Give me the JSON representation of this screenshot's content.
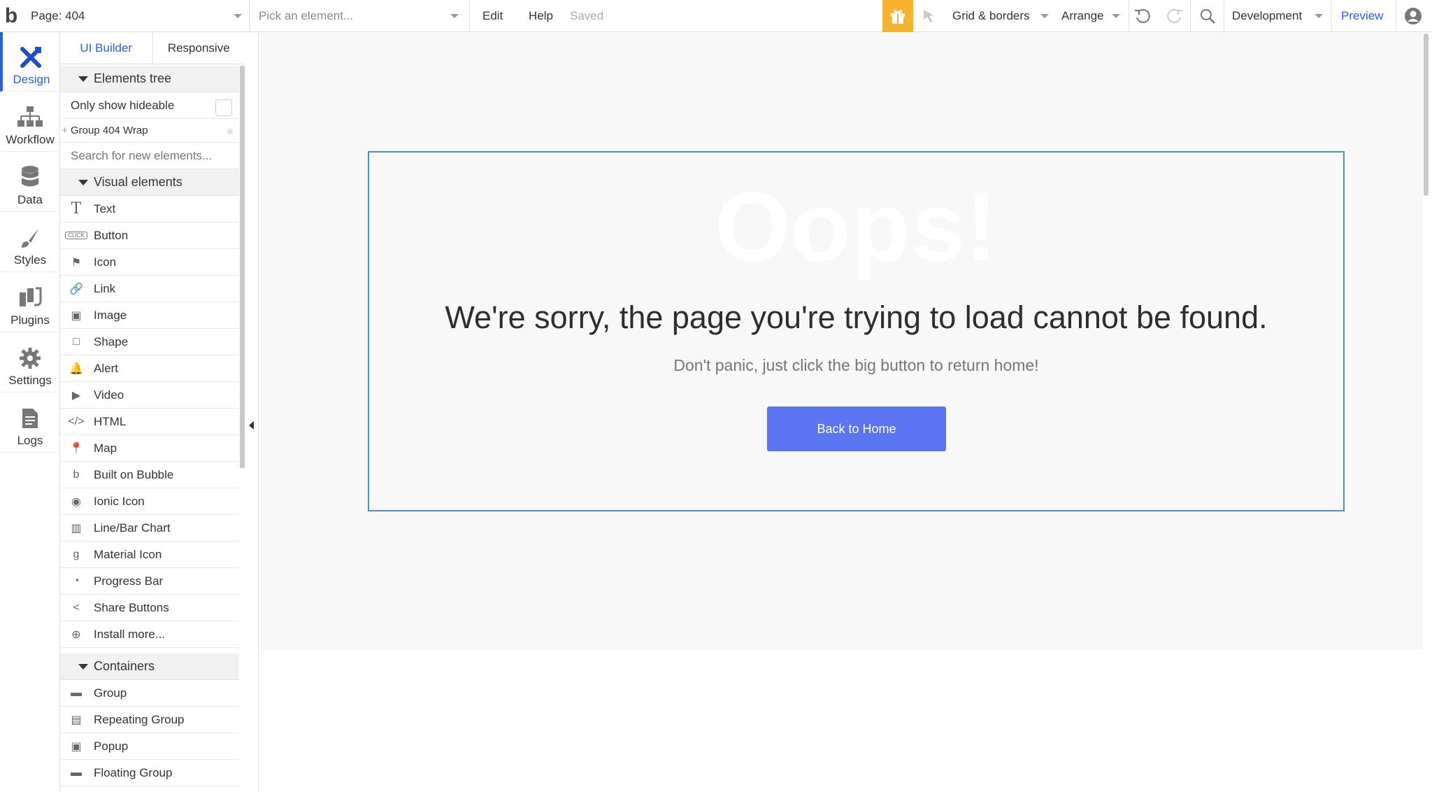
{
  "topbar": {
    "logo": "b",
    "page_label": "Page: 404",
    "element_placeholder": "Pick an element...",
    "edit": "Edit",
    "help": "Help",
    "status": "Saved",
    "grid_borders": "Grid & borders",
    "arrange": "Arrange",
    "environment": "Development",
    "preview": "Preview",
    "gift_color": "#f6b32b"
  },
  "rail": {
    "items": [
      {
        "label": "Design",
        "icon": "design-icon"
      },
      {
        "label": "Workflow",
        "icon": "workflow-icon"
      },
      {
        "label": "Data",
        "icon": "database-icon"
      },
      {
        "label": "Styles",
        "icon": "brush-icon"
      },
      {
        "label": "Plugins",
        "icon": "plug-icon"
      },
      {
        "label": "Settings",
        "icon": "gear-icon"
      },
      {
        "label": "Logs",
        "icon": "document-icon"
      }
    ]
  },
  "panel": {
    "tabs": [
      "UI Builder",
      "Responsive"
    ],
    "elements_tree": "Elements tree",
    "only_hideable": "Only show hideable",
    "tree_item": "Group 404 Wrap",
    "search_placeholder": "Search for new elements...",
    "visual_header": "Visual elements",
    "visual": [
      {
        "label": "Text",
        "icon": "T"
      },
      {
        "label": "Button",
        "icon": "CLICK"
      },
      {
        "label": "Icon",
        "icon": "⚑"
      },
      {
        "label": "Link",
        "icon": "🔗"
      },
      {
        "label": "Image",
        "icon": "▣"
      },
      {
        "label": "Shape",
        "icon": "□"
      },
      {
        "label": "Alert",
        "icon": "🔔"
      },
      {
        "label": "Video",
        "icon": "▶"
      },
      {
        "label": "HTML",
        "icon": "</>"
      },
      {
        "label": "Map",
        "icon": "📍"
      },
      {
        "label": "Built on Bubble",
        "icon": "b"
      },
      {
        "label": "Ionic Icon",
        "icon": "◉"
      },
      {
        "label": "Line/Bar Chart",
        "icon": "▥"
      },
      {
        "label": "Material Icon",
        "icon": "g"
      },
      {
        "label": "Progress Bar",
        "icon": "◔"
      },
      {
        "label": "Share Buttons",
        "icon": "<"
      },
      {
        "label": "Install more...",
        "icon": "⊕"
      }
    ],
    "containers_header": "Containers",
    "containers": [
      {
        "label": "Group",
        "icon": "▬"
      },
      {
        "label": "Repeating Group",
        "icon": "▤"
      },
      {
        "label": "Popup",
        "icon": "▣"
      },
      {
        "label": "Floating Group",
        "icon": "▬"
      }
    ]
  },
  "canvas": {
    "oops": "Oops!",
    "sorry": "We're sorry, the page you're trying to load cannot be found.",
    "panic": "Don't panic, just click the big button to return home!",
    "button": "Back to Home",
    "button_color": "#5b74f2",
    "wrap_border_color": "#4a90c8"
  }
}
